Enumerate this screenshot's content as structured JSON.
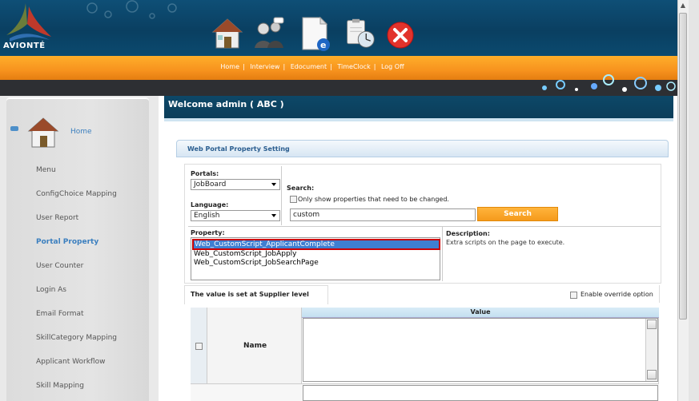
{
  "brand": {
    "logo_text": "AVIONTÉ"
  },
  "nav": {
    "items": [
      "Home",
      "Interview",
      "Edocument",
      "TimeClock",
      "Log Off"
    ],
    "separator": "|"
  },
  "sidebar": {
    "home_label": "Home",
    "items": [
      "Menu",
      "ConfigChoice Mapping",
      "User Report",
      "Portal Property",
      "User Counter",
      "Login As",
      "Email Format",
      "SkillCategory Mapping",
      "Applicant Workflow",
      "Skill Mapping"
    ],
    "active_index": 3
  },
  "welcome": {
    "text": "Welcome admin ( ABC )"
  },
  "panel": {
    "title": "Web Portal Property Setting",
    "portals_label": "Portals:",
    "portals_value": "JobBoard",
    "language_label": "Language:",
    "language_value": "English",
    "search_label": "Search:",
    "only_show_label": "Only show properties that need to be changed.",
    "search_value": "custom",
    "search_button": "Search",
    "property_label": "Property:",
    "properties": [
      "Web_CustomScript_ApplicantComplete",
      "Web_CustomScript_JobApply",
      "Web_CustomScript_JobSearchPage"
    ],
    "selected_property_index": 0,
    "description_label": "Description:",
    "description_text": "Extra scripts on the page to execute.",
    "level_text": "The value is set at Supplier level",
    "override_label": "Enable override option",
    "grid": {
      "name_header": "Name",
      "value_header": "Value"
    }
  },
  "colors": {
    "header": "#0b4568",
    "accent_orange": "#f7931e",
    "selection_blue": "#3f7fd1",
    "highlight_red": "#cc0000",
    "link_blue": "#3b7fbf"
  }
}
